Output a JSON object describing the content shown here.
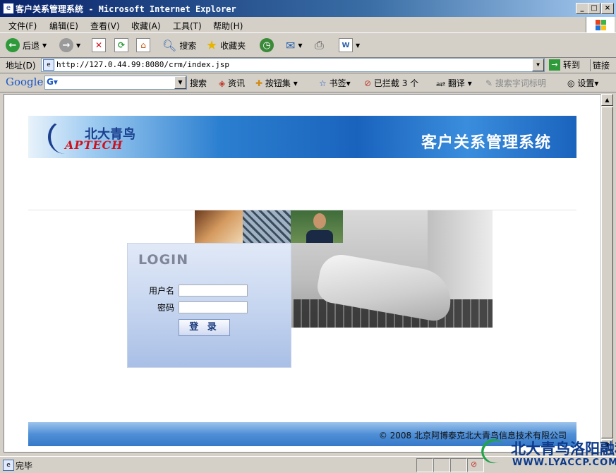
{
  "window": {
    "title": "客户关系管理系统 - Microsoft Internet Explorer",
    "controls": {
      "minimize": "_",
      "maximize": "□",
      "close": "×"
    }
  },
  "menu": [
    "文件(F)",
    "编辑(E)",
    "查看(V)",
    "收藏(A)",
    "工具(T)",
    "帮助(H)"
  ],
  "toolbar": {
    "back": "后退",
    "search": "搜索",
    "favorites": "收藏夹"
  },
  "address": {
    "label": "地址(D)",
    "url": "http://127.0.44.99:8080/crm/index.jsp",
    "go": "转到",
    "links": "链接"
  },
  "google_bar": {
    "brand": "Google",
    "search": "搜索",
    "news": "资讯",
    "buttons": "按钮集",
    "bookmarks": "书签",
    "blocked": "已拦截",
    "blocked_count": "3 个",
    "translate": "翻译",
    "highlight": "搜索字词标明",
    "settings": "设置"
  },
  "page": {
    "banner_title": "客户关系管理系统",
    "logo_cn": "北大青鸟",
    "logo_en": "APTECH",
    "login": {
      "title": "LOGIN",
      "username_label": "用户名",
      "password_label": "密码",
      "username_value": "",
      "password_value": "",
      "submit": "登 录"
    },
    "footer": "© 2008  北京阿博泰克北大青鸟信息技术有限公司"
  },
  "status": {
    "text": "完毕"
  },
  "watermark": {
    "cn": "北大青鸟洛阳融科",
    "url": "WWW.LYACCP.COM"
  },
  "colors": {
    "titlebar": "#0a246a",
    "banner": "#1a63bd",
    "footer": "#4f8fd6",
    "login_panel": "#c7d6f0"
  }
}
